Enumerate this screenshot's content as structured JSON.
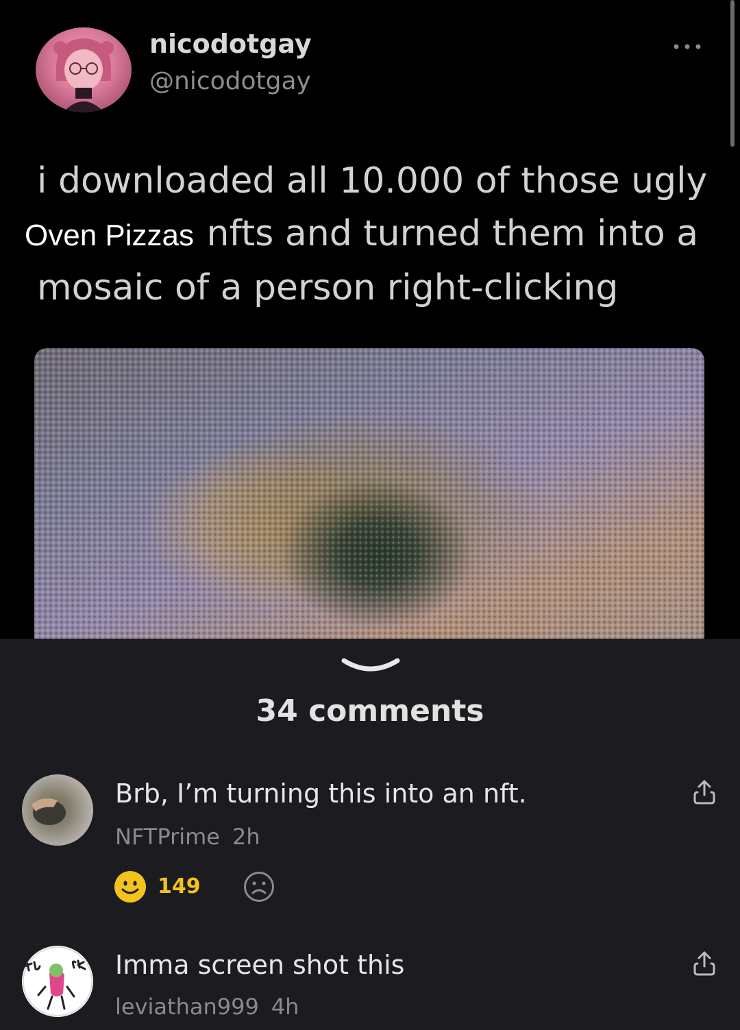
{
  "post": {
    "display_name": "nicodotgay",
    "handle": "@nicodotgay",
    "text_line1": "i downloaded all 10.000 of those ugly",
    "text_overlay": "Oven Pizzas",
    "text_line2_rest": "nfts and turned them into a",
    "text_line3": "mosaic of a person right-clicking",
    "more_icon": "more-dots-icon",
    "media_description_icon": "image"
  },
  "comments_sheet": {
    "collapse_icon": "chevron-down-icon",
    "count_label": "34 comments",
    "comments": [
      {
        "text": "Brb, I’m turning this into an nft.",
        "author": "NFTPrime",
        "time": "2h",
        "likes": "149",
        "like_icon": "smile-icon",
        "dislike_icon": "frown-icon",
        "share_icon": "share-icon"
      },
      {
        "text": "Imma screen shot this",
        "author": "leviathan999",
        "time": "4h",
        "share_icon": "share-icon"
      }
    ]
  },
  "colors": {
    "background": "#000000",
    "sheet": "#1c1b20",
    "accent_like": "#f3c21b"
  }
}
